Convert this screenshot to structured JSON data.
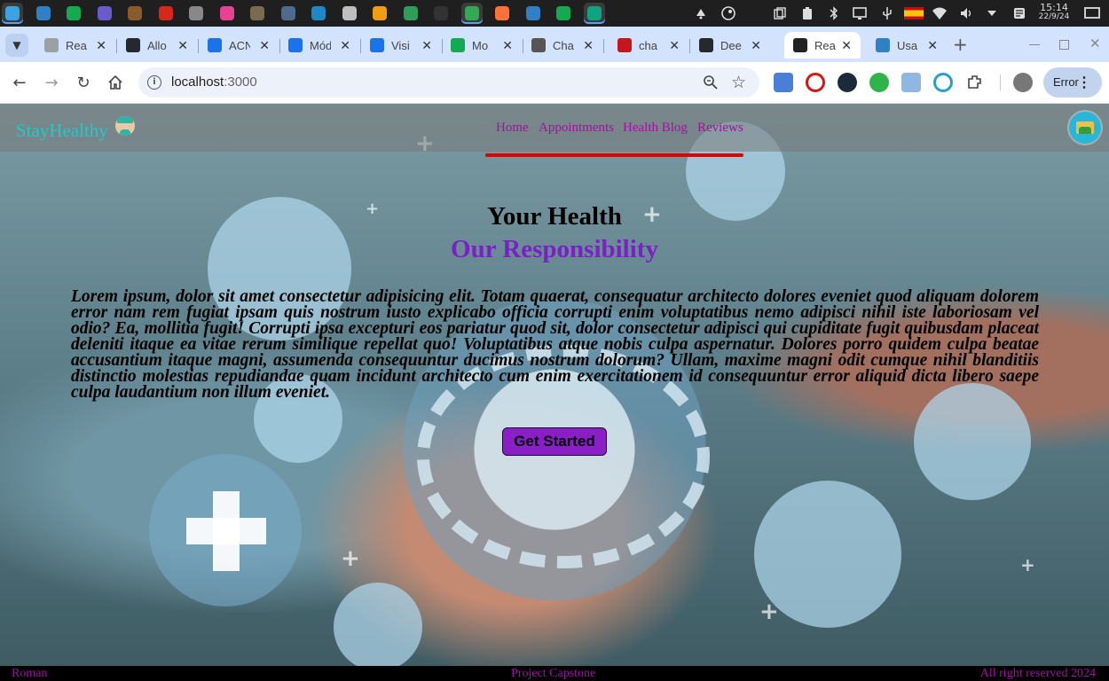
{
  "taskbar": {
    "apps": [
      {
        "name": "app-launcher-icon",
        "color": "#3aa3e3",
        "active": true
      },
      {
        "name": "vscode-icon",
        "color": "#2f80c4"
      },
      {
        "name": "mongodb-compass-icon",
        "color": "#13aa52"
      },
      {
        "name": "app-purple-icon",
        "color": "#6a5acd"
      },
      {
        "name": "minecraft-icon",
        "color": "#8b5a2b"
      },
      {
        "name": "red-triangle-app-icon",
        "color": "#d6281a"
      },
      {
        "name": "aperture-app-icon",
        "color": "#888888"
      },
      {
        "name": "color-wheel-app-icon",
        "color": "#e84393"
      },
      {
        "name": "gimp-icon",
        "color": "#7a6a4f"
      },
      {
        "name": "archive-app-icon",
        "color": "#4f6a8f"
      },
      {
        "name": "blue-circle-app-icon",
        "color": "#1e88c7"
      },
      {
        "name": "files-app-icon",
        "color": "#bfbfbf"
      },
      {
        "name": "color-picker-app-icon",
        "color": "#f29c11"
      },
      {
        "name": "android-studio-icon",
        "color": "#2e9d5a"
      },
      {
        "name": "terminal-icon",
        "color": "#333333"
      },
      {
        "name": "chrome-icon",
        "color": "#34a853",
        "active": true
      },
      {
        "name": "firefox-icon",
        "color": "#ff7139"
      },
      {
        "name": "vscode-icon-2",
        "color": "#2f80c4"
      },
      {
        "name": "mongodb-icon",
        "color": "#13aa52"
      },
      {
        "name": "chatgpt-icon",
        "color": "#10a37f",
        "active": true
      }
    ],
    "clock_time": "15:14",
    "clock_date": "22/9/24"
  },
  "tabs": [
    {
      "title": "Rea",
      "name": "tab-react-1",
      "favicon": "#9aa0a6"
    },
    {
      "title": "Allo",
      "name": "tab-github",
      "favicon": "#24292e"
    },
    {
      "title": "ACN",
      "name": "tab-acn",
      "favicon": "#1a73e8"
    },
    {
      "title": "Mód",
      "name": "tab-modulo",
      "favicon": "#1a73e8"
    },
    {
      "title": "Visi",
      "name": "tab-visi",
      "favicon": "#1a73e8"
    },
    {
      "title": "Mo",
      "name": "tab-mongo",
      "favicon": "#13aa52"
    },
    {
      "title": "Cha",
      "name": "tab-chatgpt",
      "favicon": "#555555"
    },
    {
      "title": "cha",
      "name": "tab-cha",
      "favicon": "#c4161c"
    },
    {
      "title": "Dee",
      "name": "tab-dee",
      "favicon": "#24292e"
    },
    {
      "title": "Rea",
      "name": "tab-react-active",
      "favicon": "#222222",
      "active": true
    },
    {
      "title": "Usa",
      "name": "tab-usa",
      "favicon": "#2f80c4"
    }
  ],
  "browser": {
    "url_host": "localhost",
    "url_port": ":3000",
    "profile_button_label": "Error"
  },
  "site": {
    "brand": "StayHealthy",
    "nav": [
      "Home",
      "Appointments",
      "Health Blog",
      "Reviews"
    ],
    "hero_title": "Your Health",
    "hero_subtitle": "Our Responsibility",
    "hero_text": "Lorem ipsum, dolor sit amet consectetur adipisicing elit. Totam quaerat, consequatur architecto dolores eveniet quod aliquam dolorem error nam rem fugiat ipsam quis nostrum iusto explicabo officia corrupti enim voluptatibus nemo adipisci nihil iste laboriosam vel odio? Ea, mollitia fugit! Corrupti ipsa excepturi eos pariatur quod sit, dolor consectetur adipisci qui cupiditate fugit quibusdam placeat deleniti itaque ea vitae rerum similique repellat quo! Voluptatibus atque nobis culpa aspernatur. Dolores porro quidem culpa beatae accusantium itaque magni, assumenda consequuntur ducimus nostrum dolorum? Ullam, maxime magni odit cumque nihil blanditiis distinctio molestias repudiandae quam incidunt architecto cum enim exercitationem id consequuntur error aliquid dicta libero saepe culpa laudantium non illum eveniet.",
    "cta": "Get Started",
    "footer_left": "Roman",
    "footer_center": "Project Capstone",
    "footer_right": "All right reserved 2024"
  },
  "colors": {
    "brand": "#23c9c9",
    "nav_link": "#a40fa4",
    "nav_underline": "#e00000",
    "subtitle": "#7b1fc9",
    "cta_bg": "#8a1fc8",
    "footer_text": "#a40fa4"
  }
}
